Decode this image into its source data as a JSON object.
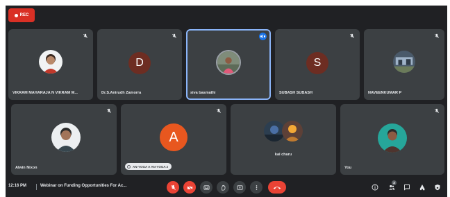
{
  "recording": {
    "label": "REC"
  },
  "tiles": [
    {
      "name": "VIKRAM MAHARAJA N VIKRAM M..."
    },
    {
      "name": "Dr.S.Anirudh Zamorra",
      "initial": "D"
    },
    {
      "name": "siva basmathi"
    },
    {
      "name": "SUBASH SUBASH",
      "initial": "S"
    },
    {
      "name": "NAVEENKUMAR P"
    },
    {
      "name": "Alwin Nixon"
    },
    {
      "name": "",
      "initial": "A",
      "pill": "AN-YOGA A AN-YOGA 2"
    },
    {
      "name": "kai charu"
    },
    {
      "name": "You"
    }
  ],
  "bottom_bar": {
    "time": "12:16 PM",
    "meeting_title": "Webinar on Funding Opportunities For Ac...",
    "participants_count": "3"
  },
  "colors": {
    "background": "#202124",
    "tile": "#3c4043",
    "accent": "#1a73e8",
    "danger": "#ea4335",
    "avatar_d": "#6d2d22",
    "avatar_s": "#6d2d22",
    "avatar_a": "#e8571f"
  }
}
